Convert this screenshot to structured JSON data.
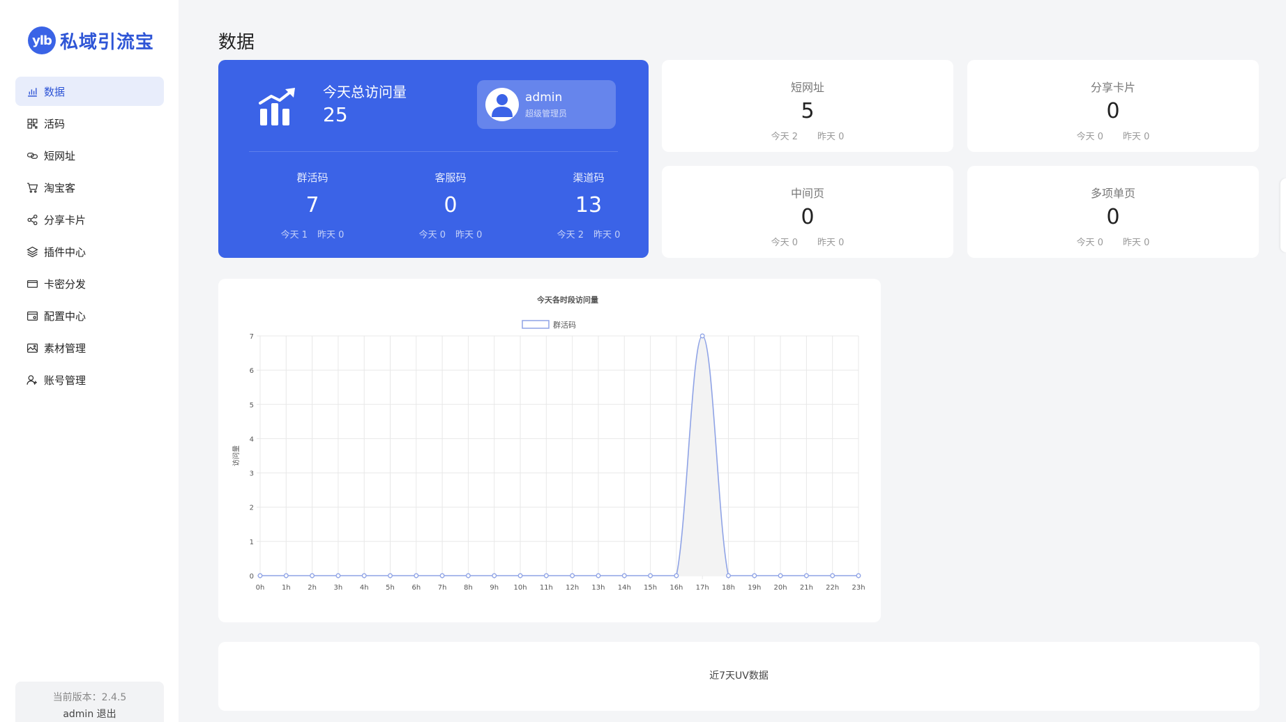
{
  "brand": {
    "badge": "ylb",
    "name": "私域引流宝"
  },
  "sidebar": {
    "items": [
      {
        "label": "数据",
        "icon": "bar-chart-icon",
        "active": true
      },
      {
        "label": "活码",
        "icon": "grid-icon"
      },
      {
        "label": "短网址",
        "icon": "link-icon"
      },
      {
        "label": "淘宝客",
        "icon": "cart-icon"
      },
      {
        "label": "分享卡片",
        "icon": "share-icon"
      },
      {
        "label": "插件中心",
        "icon": "layers-icon"
      },
      {
        "label": "卡密分发",
        "icon": "card-icon"
      },
      {
        "label": "配置中心",
        "icon": "config-icon"
      },
      {
        "label": "素材管理",
        "icon": "image-icon"
      },
      {
        "label": "账号管理",
        "icon": "user-add-icon"
      }
    ],
    "version": "当前版本：2.4.5",
    "user": "admin",
    "logout": "退出"
  },
  "page": {
    "title": "数据"
  },
  "hero": {
    "label": "今天总访问量",
    "value": "25",
    "admin_name": "admin",
    "admin_role": "超级管理员",
    "stats": [
      {
        "label": "群活码",
        "value": "7",
        "today": "今天 1",
        "yesterday": "昨天 0"
      },
      {
        "label": "客服码",
        "value": "0",
        "today": "今天 0",
        "yesterday": "昨天 0"
      },
      {
        "label": "渠道码",
        "value": "13",
        "today": "今天 2",
        "yesterday": "昨天 0"
      }
    ]
  },
  "cards": [
    {
      "label": "短网址",
      "value": "5",
      "today": "今天 2",
      "yesterday": "昨天 0"
    },
    {
      "label": "分享卡片",
      "value": "0",
      "today": "今天 0",
      "yesterday": "昨天 0"
    },
    {
      "label": "中间页",
      "value": "0",
      "today": "今天 0",
      "yesterday": "昨天 0"
    },
    {
      "label": "多项单页",
      "value": "0",
      "today": "今天 0",
      "yesterday": "昨天 0"
    }
  ],
  "chart_data": {
    "type": "line",
    "title": "今天各时段访问量",
    "ylabel": "访问量",
    "xlabel": "",
    "x": [
      "0h",
      "1h",
      "2h",
      "3h",
      "4h",
      "5h",
      "6h",
      "7h",
      "8h",
      "9h",
      "10h",
      "11h",
      "12h",
      "13h",
      "14h",
      "15h",
      "16h",
      "17h",
      "18h",
      "19h",
      "20h",
      "21h",
      "22h",
      "23h"
    ],
    "series": [
      {
        "name": "群活码",
        "values": [
          0,
          0,
          0,
          0,
          0,
          0,
          0,
          0,
          0,
          0,
          0,
          0,
          0,
          0,
          0,
          0,
          0,
          7,
          0,
          0,
          0,
          0,
          0,
          0
        ]
      }
    ],
    "ylim": [
      0,
      7
    ],
    "yticks": [
      "0",
      "1",
      "2",
      "3",
      "4",
      "5",
      "6",
      "7"
    ],
    "grid": true,
    "legend": "top-center",
    "line_color": "#8fa3e6",
    "fill_color": "#f3f3f3"
  },
  "uv": {
    "title": "近7天UV数据"
  },
  "colors": {
    "primary": "#3b63e7",
    "active_bg": "#e8edfb",
    "page_bg": "#f4f5f7"
  }
}
